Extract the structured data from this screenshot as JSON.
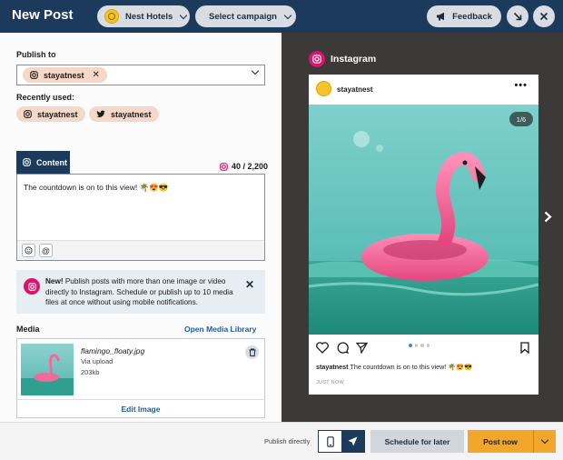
{
  "header": {
    "title": "New Post",
    "organization": "Nest Hotels",
    "campaign": "Select campaign",
    "feedback": "Feedback"
  },
  "composer": {
    "publish_to_label": "Publish to",
    "selected_account": "stayatnest",
    "recently_used_label": "Recently used:",
    "recent_accounts": [
      {
        "network": "instagram",
        "name": "stayatnest"
      },
      {
        "network": "twitter",
        "name": "stayatnest"
      }
    ],
    "content_tab": "Content",
    "char_count": "40 / 2,200",
    "text": "The countdown is on to this view! 🌴😍😎",
    "notice": {
      "bold": "New!",
      "message": " Publish posts with more than one image or video directly to Instagram. Schedule or publish up to 10 media files at once without using mobile notifications."
    },
    "media_label": "Media",
    "open_media_library": "Open Media Library",
    "media_file": {
      "name": "flamingo_floaty.jpg",
      "source": "Via upload",
      "size": "203kb"
    },
    "edit_image": "Edit Image"
  },
  "preview": {
    "network": "Instagram",
    "handle": "stayatnest",
    "image_counter": "1/6",
    "caption_handle": "stayatnest",
    "caption_text": " The countdown is on to this view! 🌴😍😎",
    "timestamp": "JUST NOW",
    "carousel": {
      "current": 1,
      "dots": 4
    }
  },
  "footer": {
    "publish_directly": "Publish directly",
    "schedule": "Schedule for later",
    "post_now": "Post now"
  },
  "colors": {
    "navy": "#1b3a5c",
    "instagram_pink": "#d6156b",
    "chip_peach": "#f6d8c8",
    "post_orange": "#f2a72c",
    "preview_bg": "#3b3a39"
  },
  "icons": [
    "org-avatar-icon",
    "chevron-down-icon",
    "megaphone-icon",
    "minimize-icon",
    "close-icon",
    "instagram-icon",
    "twitter-icon",
    "emoji-icon",
    "mention-icon",
    "trash-icon",
    "more-icon",
    "heart-icon",
    "comment-icon",
    "send-icon",
    "bookmark-icon",
    "chevron-right-icon",
    "mobile-icon",
    "paper-plane-icon"
  ]
}
